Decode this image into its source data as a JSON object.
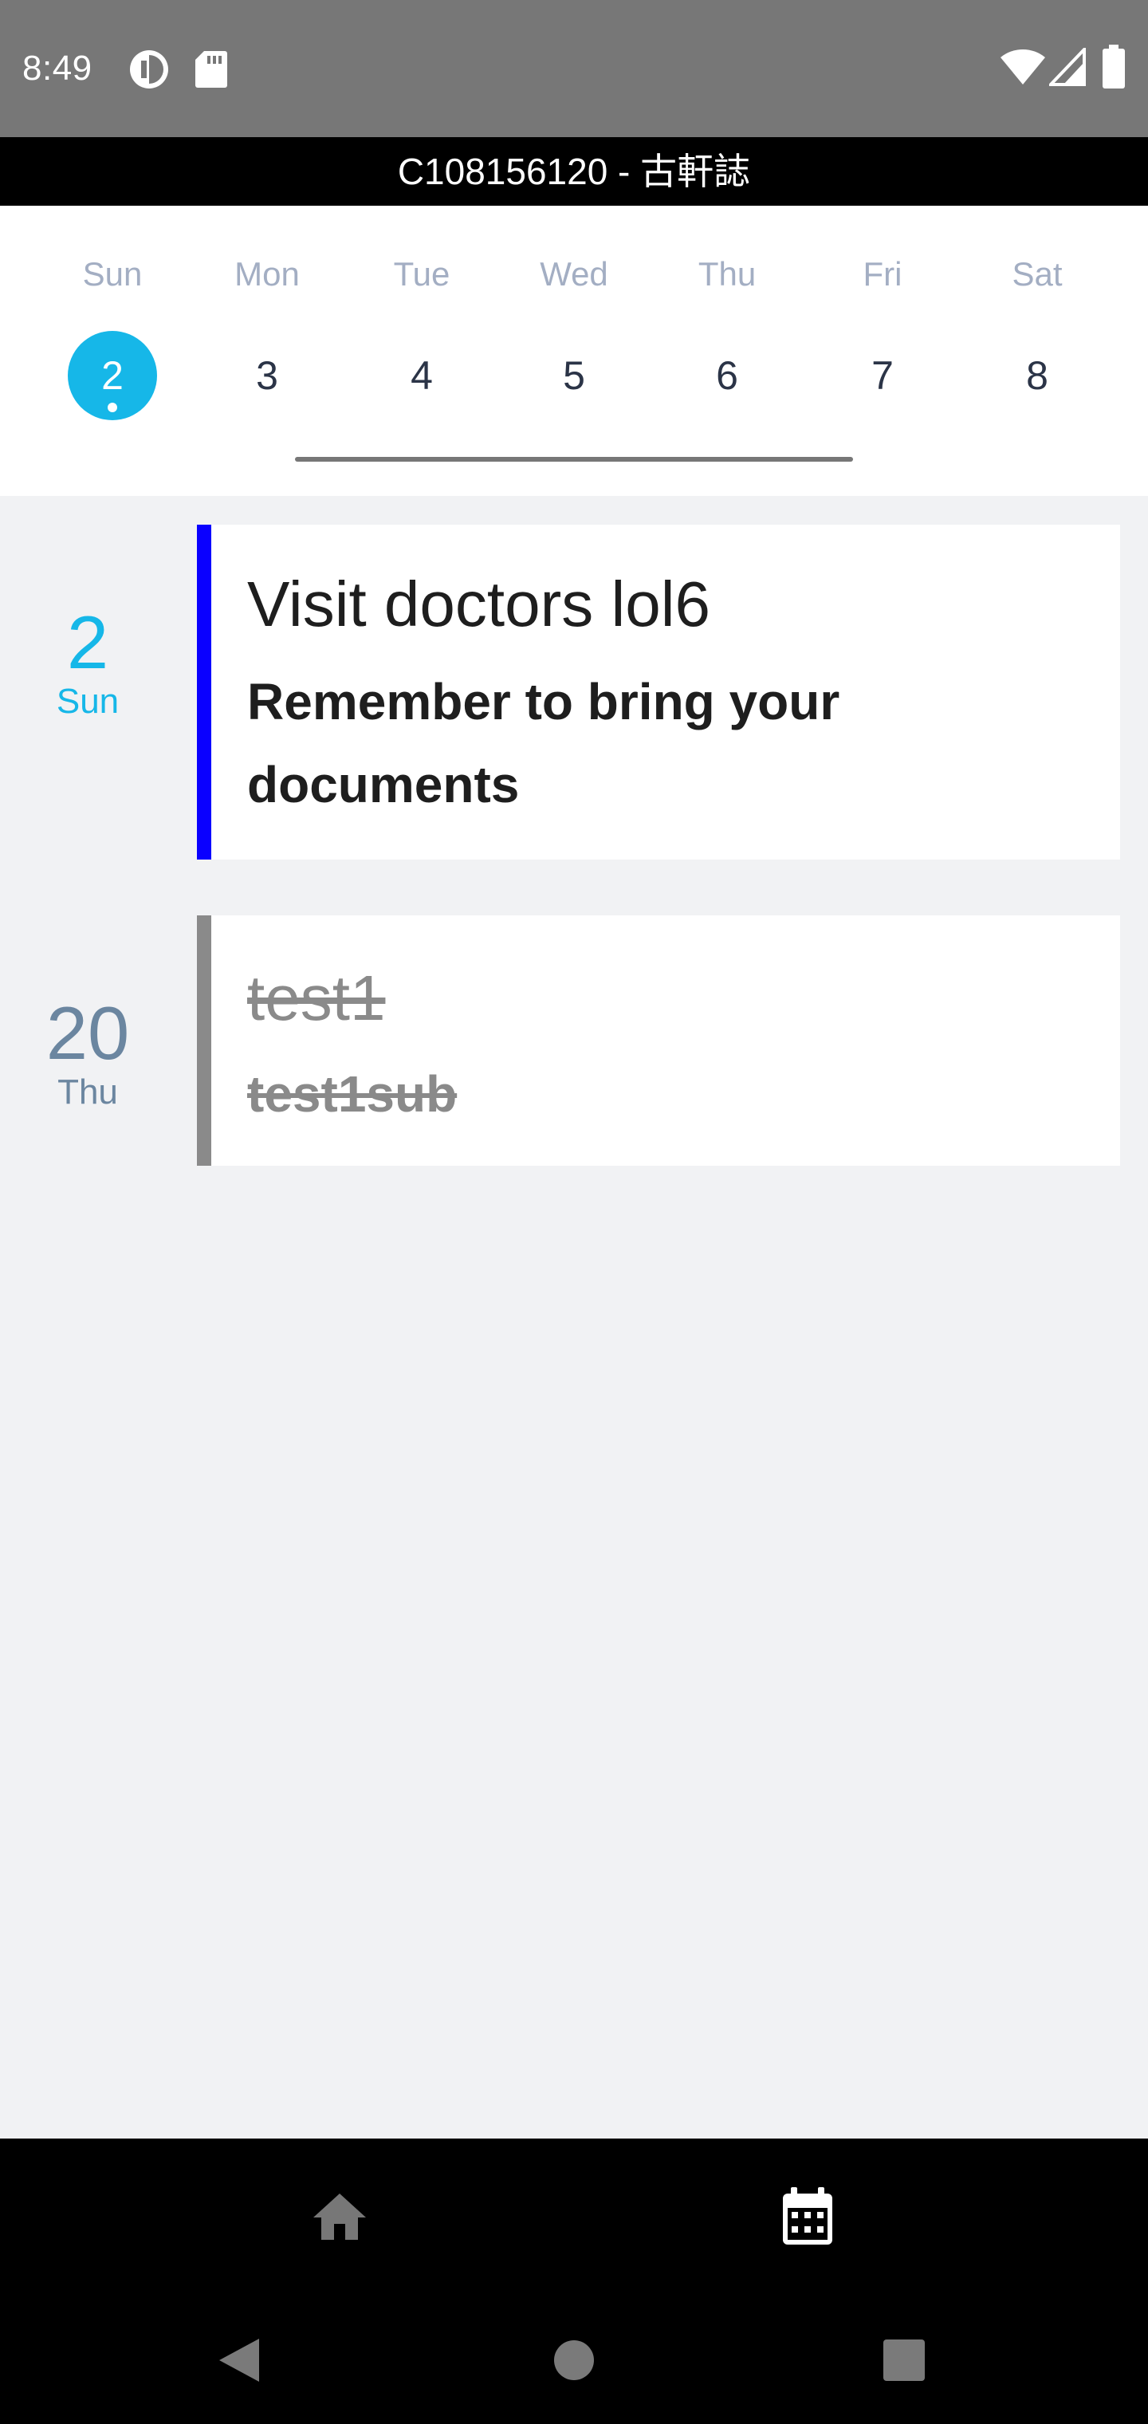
{
  "status_bar": {
    "time": "8:49",
    "icons": [
      "sync-icon",
      "sd-card-icon",
      "wifi-icon",
      "cell-signal-icon",
      "battery-icon"
    ]
  },
  "header": {
    "title": "C108156120 - 古軒誌"
  },
  "week": {
    "days": [
      {
        "name": "Sun",
        "num": "2",
        "selected": true,
        "has_event": true
      },
      {
        "name": "Mon",
        "num": "3",
        "selected": false,
        "has_event": false
      },
      {
        "name": "Tue",
        "num": "4",
        "selected": false,
        "has_event": false
      },
      {
        "name": "Wed",
        "num": "5",
        "selected": false,
        "has_event": false
      },
      {
        "name": "Thu",
        "num": "6",
        "selected": false,
        "has_event": false
      },
      {
        "name": "Fri",
        "num": "7",
        "selected": false,
        "has_event": false
      },
      {
        "name": "Sat",
        "num": "8",
        "selected": false,
        "has_event": false
      }
    ]
  },
  "agenda": [
    {
      "date_num": "2",
      "date_day": "Sun",
      "title": "Visit doctors lol6",
      "subtitle_line1": "Remember to bring your",
      "subtitle_line2": "documents",
      "completed": false,
      "accent_color": "#0a00ff"
    },
    {
      "date_num": "20",
      "date_day": "Thu",
      "title": "test1",
      "subtitle_line1": "test1sub",
      "completed": true,
      "accent_color": "#8a8a8a"
    }
  ],
  "bottom_nav": {
    "items": [
      {
        "icon": "home-icon",
        "active": false
      },
      {
        "icon": "calendar-icon",
        "active": true
      }
    ]
  },
  "system_nav": {
    "items": [
      "back-icon",
      "home-circle-icon",
      "recents-icon"
    ]
  },
  "colors": {
    "accent": "#16b7e8",
    "event_bar": "#0a00ff",
    "done_bar": "#8a8a8a",
    "background": "#f1f2f4"
  }
}
